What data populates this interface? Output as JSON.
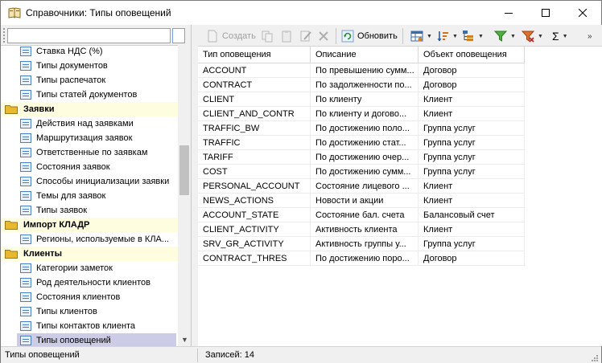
{
  "window": {
    "title": "Справочники: Типы оповещений"
  },
  "search": {
    "value": "",
    "placeholder": ""
  },
  "tree": {
    "rows": [
      {
        "kind": "item",
        "label": "Ставка НДС (%)"
      },
      {
        "kind": "item",
        "label": "Типы документов"
      },
      {
        "kind": "item",
        "label": "Типы распечаток"
      },
      {
        "kind": "item",
        "label": "Типы статей документов"
      },
      {
        "kind": "group",
        "label": "Заявки"
      },
      {
        "kind": "item",
        "label": "Действия над заявками"
      },
      {
        "kind": "item",
        "label": "Маршрутизация заявок"
      },
      {
        "kind": "item",
        "label": "Ответственные по заявкам"
      },
      {
        "kind": "item",
        "label": "Состояния заявок"
      },
      {
        "kind": "item",
        "label": "Способы инициализации заявки"
      },
      {
        "kind": "item",
        "label": "Темы для заявок"
      },
      {
        "kind": "item",
        "label": "Типы заявок"
      },
      {
        "kind": "group",
        "label": "Импорт КЛАДР"
      },
      {
        "kind": "item",
        "label": "Регионы, используемые в КЛА..."
      },
      {
        "kind": "group",
        "label": "Клиенты"
      },
      {
        "kind": "item",
        "label": "Категории заметок"
      },
      {
        "kind": "item",
        "label": "Род деятельности клиентов"
      },
      {
        "kind": "item",
        "label": "Состояния клиентов"
      },
      {
        "kind": "item",
        "label": "Типы клиентов"
      },
      {
        "kind": "item",
        "label": "Типы контактов клиента"
      },
      {
        "kind": "item",
        "label": "Типы оповещений",
        "selected": true
      }
    ]
  },
  "toolbar": {
    "create_label": "Создать",
    "refresh_label": "Обновить",
    "sum_label": "Σ"
  },
  "grid": {
    "columns": [
      "Тип оповещения",
      "Описание",
      "Объект оповещения"
    ],
    "rows": [
      [
        "ACCOUNT",
        "По превышению сумм...",
        "Договор"
      ],
      [
        "CONTRACT",
        "По задолженности по...",
        "Договор"
      ],
      [
        "CLIENT",
        "По клиенту",
        "Клиент"
      ],
      [
        "CLIENT_AND_CONTR",
        "По клиенту и догово...",
        "Клиент"
      ],
      [
        "TRAFFIC_BW",
        "По достижению поло...",
        "Группа услуг"
      ],
      [
        "TRAFFIC",
        "По достижению стат...",
        "Группа услуг"
      ],
      [
        "TARIFF",
        "По достижению очер...",
        "Группа услуг"
      ],
      [
        "COST",
        "По достижению сумм...",
        "Группа услуг"
      ],
      [
        "PERSONAL_ACCOUNT",
        "Состояние лицевого ...",
        "Клиент"
      ],
      [
        "NEWS_ACTIONS",
        "Новости и акции",
        "Клиент"
      ],
      [
        "ACCOUNT_STATE",
        "Состояние бал. счета",
        "Балансовый счет"
      ],
      [
        "CLIENT_ACTIVITY",
        "Активность клиента",
        "Клиент"
      ],
      [
        "SRV_GR_ACTIVITY",
        "Активность группы у...",
        "Группа услуг"
      ],
      [
        "CONTRACT_THRES",
        "По достижению поро...",
        "Договор"
      ]
    ]
  },
  "status": {
    "left": "Типы оповещений",
    "right": "Записей: 14"
  },
  "colors": {
    "selection": "#cccce6",
    "group_bg": "#fffde0",
    "folder": "#e8b830"
  }
}
